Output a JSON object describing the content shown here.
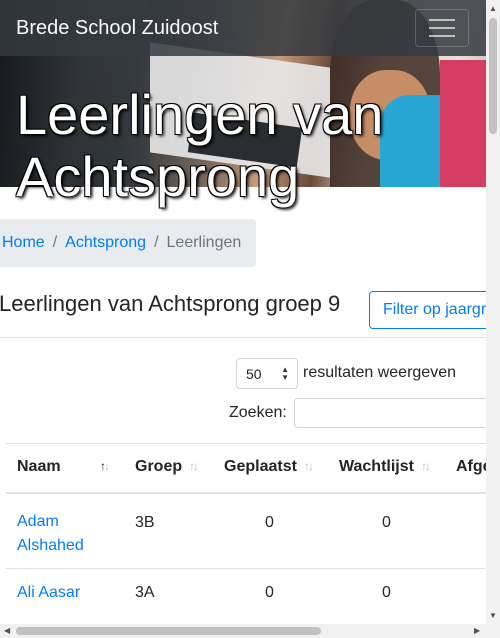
{
  "navbar": {
    "brand": "Brede School Zuidoost"
  },
  "hero": {
    "title": "Leerlingen van Achtsprong"
  },
  "breadcrumb": {
    "home": "Home",
    "parent": "Achtsprong",
    "current": "Leerlingen",
    "separator": "/"
  },
  "group": {
    "heading": "Leerlingen van Achtsprong groep 9",
    "filter_label": "Filter op jaargroep"
  },
  "datatable": {
    "length_value": "50",
    "length_label": "resultaten weergeven",
    "search_label": "Zoeken:",
    "search_value": "",
    "columns": [
      "Naam",
      "Groep",
      "Geplaatst",
      "Wachtlijst",
      "Afgewezen"
    ],
    "rows": [
      {
        "naam": "Adam Alshahed",
        "groep": "3B",
        "geplaatst": "0",
        "wachtlijst": "0"
      },
      {
        "naam": "Ali Aasar",
        "groep": "3A",
        "geplaatst": "0",
        "wachtlijst": "0"
      }
    ]
  },
  "colors": {
    "link": "#007bff",
    "navbar": "#343a40",
    "breadcrumb_bg": "#e9ecef"
  }
}
